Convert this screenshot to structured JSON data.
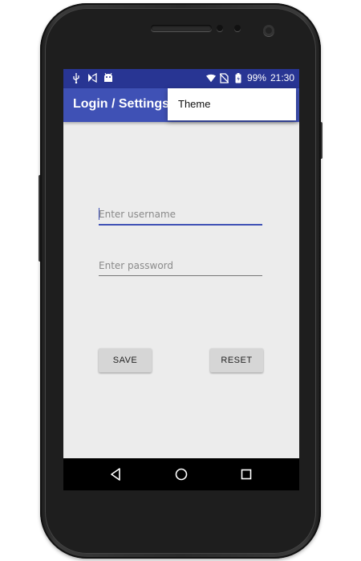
{
  "status_bar": {
    "battery": "99%",
    "time": "21:30",
    "icons": [
      "usb-icon",
      "download-icon",
      "android-icon",
      "wifi-icon",
      "no-sim-icon",
      "battery-icon"
    ]
  },
  "app_bar": {
    "title": "Login / Settings"
  },
  "overflow_menu": {
    "items": [
      {
        "label": "Theme"
      }
    ]
  },
  "form": {
    "username_placeholder": "Enter username",
    "password_placeholder": "Enter password",
    "save_label": "SAVE",
    "reset_label": "RESET"
  },
  "nav_bar": {
    "icons": [
      "back-icon",
      "home-icon",
      "recents-icon"
    ]
  },
  "colors": {
    "status_bar": "#283593",
    "app_bar": "#3f51b5",
    "background": "#ececec",
    "button": "#d6d6d6"
  }
}
